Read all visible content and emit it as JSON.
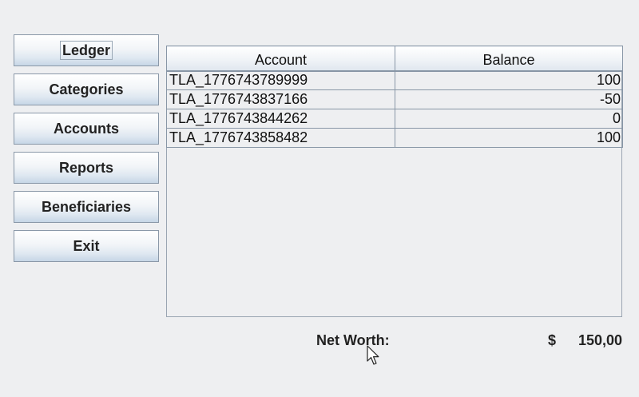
{
  "nav": {
    "items": [
      {
        "label": "Ledger"
      },
      {
        "label": "Categories"
      },
      {
        "label": "Accounts"
      },
      {
        "label": "Reports"
      },
      {
        "label": "Beneficiaries"
      },
      {
        "label": "Exit"
      }
    ]
  },
  "table": {
    "columns": [
      "Account",
      "Balance"
    ],
    "rows": [
      {
        "account": "TLA_1776743789999",
        "balance": "100"
      },
      {
        "account": "TLA_1776743837166",
        "balance": "-50"
      },
      {
        "account": "TLA_1776743844262",
        "balance": "0"
      },
      {
        "account": "TLA_1776743858482",
        "balance": "100"
      }
    ]
  },
  "footer": {
    "net_worth_label": "Net Worth:",
    "currency": "$",
    "net_worth_value": "150,00"
  },
  "icons": {
    "cursor": "mouse-pointer-icon"
  }
}
